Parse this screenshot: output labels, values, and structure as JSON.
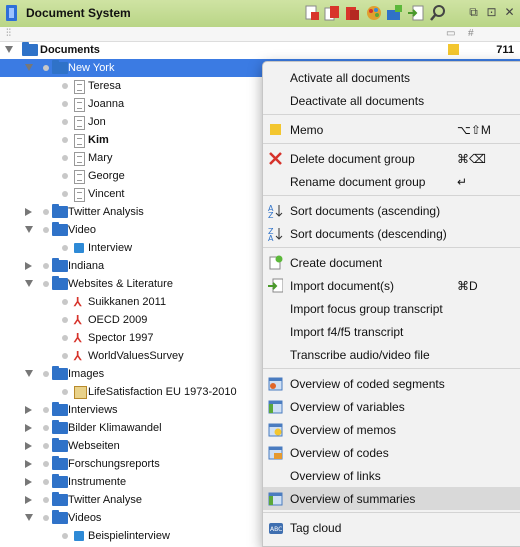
{
  "window": {
    "title": "Document System"
  },
  "toolbar": {
    "icons": [
      "new-doc-icon",
      "copy-doc-icon",
      "docs-icon",
      "palette-icon",
      "new-group-icon",
      "import-icon",
      "arrow-icon",
      "search-icon"
    ]
  },
  "window_controls": {
    "restore": "⧉",
    "maximize": "⊡",
    "close": "✕"
  },
  "columns": {
    "name": "",
    "memo": "",
    "count": "#"
  },
  "tree": {
    "root": {
      "label": "Documents",
      "count": "711"
    },
    "rows": [
      {
        "label": "New York",
        "type": "folder",
        "state": "expanded",
        "selected": true
      },
      {
        "label": "Teresa",
        "type": "doc"
      },
      {
        "label": "Joanna",
        "type": "doc"
      },
      {
        "label": "Jon",
        "type": "doc"
      },
      {
        "label": "Kim",
        "type": "doc",
        "bold": true
      },
      {
        "label": "Mary",
        "type": "doc"
      },
      {
        "label": "George",
        "type": "doc"
      },
      {
        "label": "Vincent",
        "type": "doc"
      },
      {
        "label": "Twitter Analysis",
        "type": "folder",
        "state": "collapsed"
      },
      {
        "label": "Video",
        "type": "folder",
        "state": "expanded"
      },
      {
        "label": "Interview",
        "type": "video"
      },
      {
        "label": "Indiana",
        "type": "folder",
        "state": "collapsed"
      },
      {
        "label": "Websites & Literature",
        "type": "folder",
        "state": "expanded"
      },
      {
        "label": "Suikkanen 2011",
        "type": "pdf"
      },
      {
        "label": "OECD 2009",
        "type": "pdf"
      },
      {
        "label": "Spector 1997",
        "type": "pdf"
      },
      {
        "label": "WorldValuesSurvey",
        "type": "pdf"
      },
      {
        "label": "Images",
        "type": "folder",
        "state": "expanded"
      },
      {
        "label": "LifeSatisfaction EU 1973-2010",
        "type": "image"
      },
      {
        "label": "Interviews",
        "type": "folder",
        "state": "collapsed"
      },
      {
        "label": "Bilder Klimawandel",
        "type": "folder",
        "state": "collapsed"
      },
      {
        "label": "Webseiten",
        "type": "folder",
        "state": "collapsed"
      },
      {
        "label": "Forschungsreports",
        "type": "folder",
        "state": "collapsed"
      },
      {
        "label": "Instrumente",
        "type": "folder",
        "state": "collapsed"
      },
      {
        "label": "Twitter Analyse",
        "type": "folder",
        "state": "collapsed"
      },
      {
        "label": "Videos",
        "type": "folder",
        "state": "expanded"
      },
      {
        "label": "Beispielinterview",
        "type": "video"
      }
    ]
  },
  "context_menu": {
    "items": [
      {
        "label": "Activate all documents",
        "shortcut": "",
        "icon": ""
      },
      {
        "label": "Deactivate all documents",
        "shortcut": "",
        "icon": ""
      },
      {
        "sep": true
      },
      {
        "label": "Memo",
        "shortcut": "⌥⇧M",
        "icon": "memo-icon"
      },
      {
        "sep": true
      },
      {
        "label": "Delete document group",
        "shortcut": "⌘⌫",
        "icon": "delete-icon"
      },
      {
        "label": "Rename document group",
        "shortcut": "↵",
        "icon": ""
      },
      {
        "sep": true
      },
      {
        "label": "Sort documents (ascending)",
        "shortcut": "",
        "icon": "sort-ascending-icon"
      },
      {
        "label": "Sort documents (descending)",
        "shortcut": "",
        "icon": "sort-descending-icon"
      },
      {
        "sep": true
      },
      {
        "label": "Create document",
        "shortcut": "",
        "icon": "create-document-icon"
      },
      {
        "label": "Import document(s)",
        "shortcut": "⌘D",
        "icon": "import-document-icon"
      },
      {
        "label": "Import focus group transcript",
        "shortcut": "",
        "icon": ""
      },
      {
        "label": "Import f4/f5 transcript",
        "shortcut": "",
        "icon": ""
      },
      {
        "label": "Transcribe audio/video file",
        "shortcut": "",
        "icon": ""
      },
      {
        "sep": true
      },
      {
        "label": "Overview of coded segments",
        "shortcut": "",
        "icon": "coded-segments-icon"
      },
      {
        "label": "Overview of variables",
        "shortcut": "",
        "icon": "variables-icon"
      },
      {
        "label": "Overview of memos",
        "shortcut": "",
        "icon": "memos-overview-icon"
      },
      {
        "label": "Overview of codes",
        "shortcut": "",
        "icon": "codes-overview-icon"
      },
      {
        "label": "Overview of links",
        "shortcut": "",
        "icon": ""
      },
      {
        "label": "Overview of summaries",
        "shortcut": "",
        "icon": "summaries-icon",
        "highlighted": true
      },
      {
        "sep": true
      },
      {
        "label": "Tag cloud",
        "shortcut": "",
        "icon": "tag-cloud-icon"
      }
    ]
  },
  "colors": {
    "selection": "#3b7be3",
    "titlebar": "#c4dc95",
    "folder": "#2f72c8",
    "memo": "#f3c62f",
    "delete": "#d6322a"
  }
}
